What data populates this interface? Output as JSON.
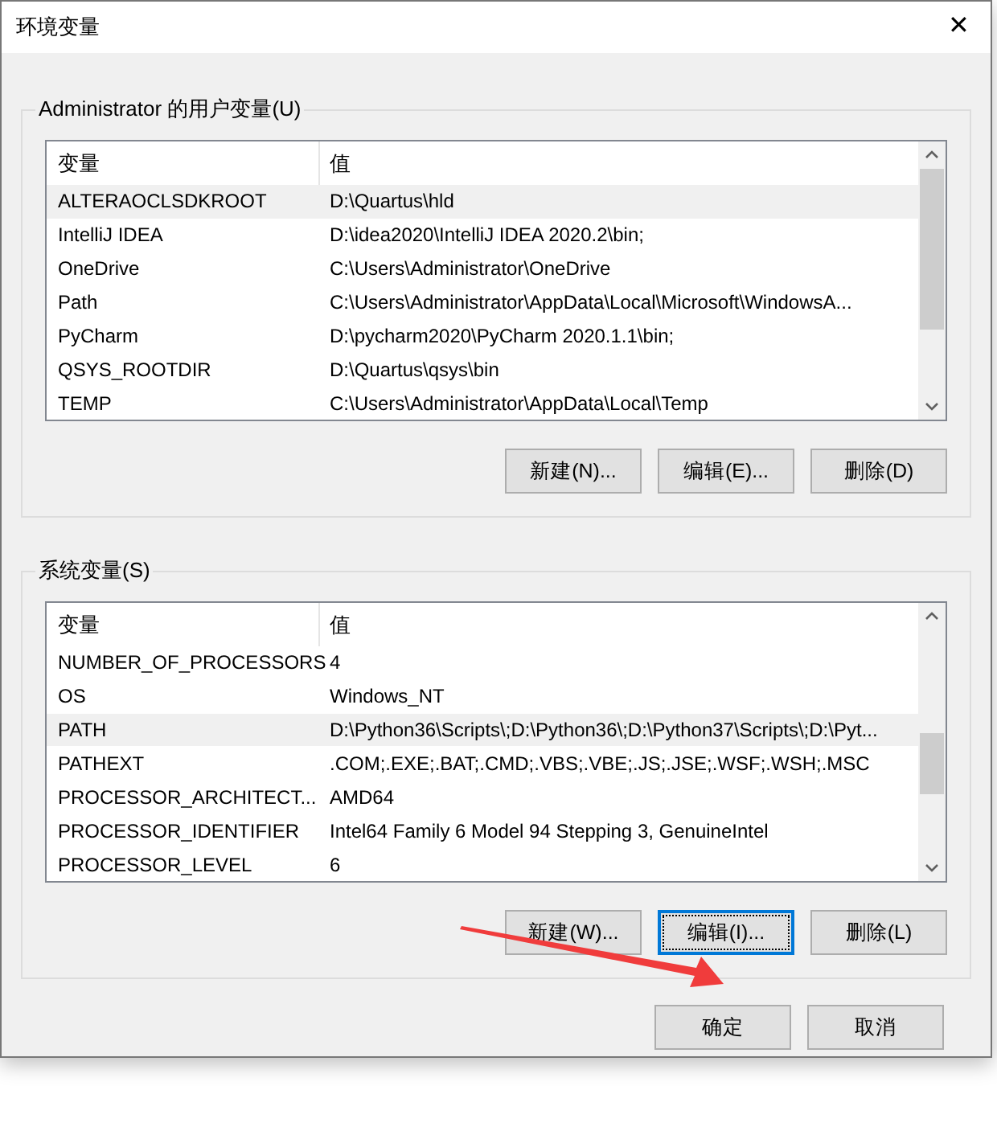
{
  "window": {
    "title": "环境变量",
    "close": "✕"
  },
  "groups": [
    {
      "label": "Administrator 的用户变量(U)",
      "columns": [
        "变量",
        "值"
      ],
      "rows": [
        {
          "name": "ALTERAOCLSDKROOT",
          "value": "D:\\Quartus\\hld",
          "selected": true
        },
        {
          "name": "IntelliJ IDEA",
          "value": "D:\\idea2020\\IntelliJ IDEA 2020.2\\bin;",
          "selected": false
        },
        {
          "name": "OneDrive",
          "value": "C:\\Users\\Administrator\\OneDrive",
          "selected": false
        },
        {
          "name": "Path",
          "value": "C:\\Users\\Administrator\\AppData\\Local\\Microsoft\\WindowsA...",
          "selected": false
        },
        {
          "name": "PyCharm",
          "value": "D:\\pycharm2020\\PyCharm 2020.1.1\\bin;",
          "selected": false
        },
        {
          "name": "QSYS_ROOTDIR",
          "value": "D:\\Quartus\\qsys\\bin",
          "selected": false
        },
        {
          "name": "TEMP",
          "value": "C:\\Users\\Administrator\\AppData\\Local\\Temp",
          "selected": false
        }
      ],
      "buttons": [
        {
          "label": "新建(N)...",
          "focused": false
        },
        {
          "label": "编辑(E)...",
          "focused": false
        },
        {
          "label": "删除(D)",
          "focused": false
        }
      ]
    },
    {
      "label": "系统变量(S)",
      "columns": [
        "变量",
        "值"
      ],
      "rows": [
        {
          "name": "NUMBER_OF_PROCESSORS",
          "value": "4",
          "selected": false
        },
        {
          "name": "OS",
          "value": "Windows_NT",
          "selected": false
        },
        {
          "name": "PATH",
          "value": "D:\\Python36\\Scripts\\;D:\\Python36\\;D:\\Python37\\Scripts\\;D:\\Pyt...",
          "selected": true
        },
        {
          "name": "PATHEXT",
          "value": ".COM;.EXE;.BAT;.CMD;.VBS;.VBE;.JS;.JSE;.WSF;.WSH;.MSC",
          "selected": false
        },
        {
          "name": "PROCESSOR_ARCHITECT...",
          "value": "AMD64",
          "selected": false
        },
        {
          "name": "PROCESSOR_IDENTIFIER",
          "value": "Intel64 Family 6 Model 94 Stepping 3, GenuineIntel",
          "selected": false
        },
        {
          "name": "PROCESSOR_LEVEL",
          "value": "6",
          "selected": false
        }
      ],
      "buttons": [
        {
          "label": "新建(W)...",
          "focused": false
        },
        {
          "label": "编辑(I)...",
          "focused": true
        },
        {
          "label": "删除(L)",
          "focused": false
        }
      ]
    }
  ],
  "footer_buttons": [
    {
      "label": "确定"
    },
    {
      "label": "取消"
    }
  ]
}
